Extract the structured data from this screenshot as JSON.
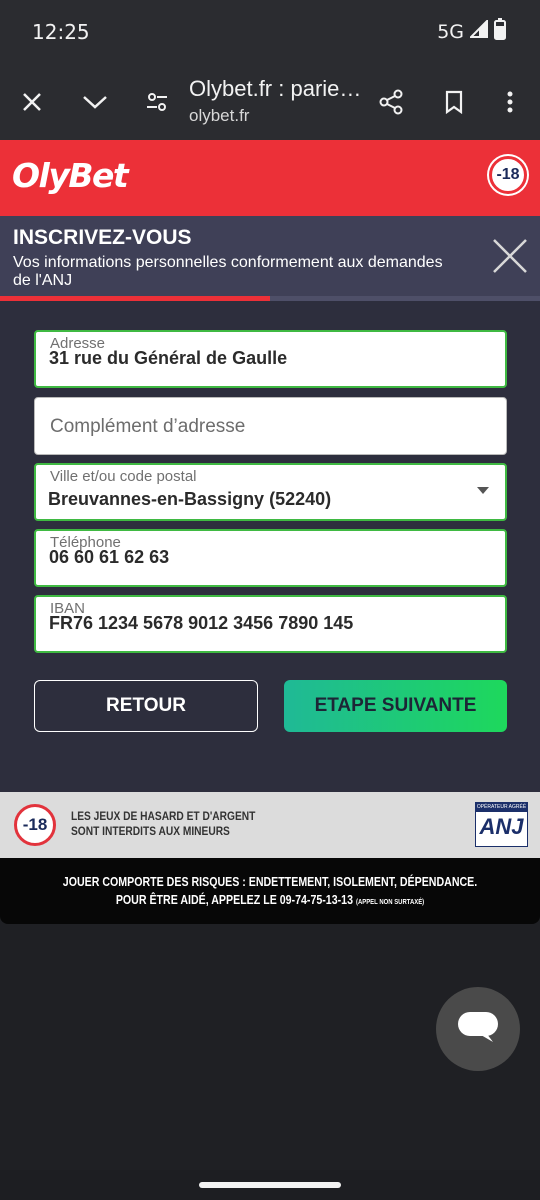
{
  "status_bar": {
    "time": "12:25",
    "network": "5G"
  },
  "browser": {
    "title": "Olybet.fr : parie…",
    "url": "olybet.fr",
    "icons": [
      "close-icon",
      "chevron-down-icon",
      "tune-icon",
      "share-icon",
      "bookmark-icon",
      "more-vert-icon"
    ]
  },
  "header": {
    "logo": "OlyBet",
    "age_badge": "-18"
  },
  "registration": {
    "title": "INSCRIVEZ-VOUS",
    "subtitle": "Vos informations personnelles conformement aux demandes de l'ANJ",
    "progress_fraction": 0.5,
    "fields": {
      "address": {
        "label": "Adresse",
        "value": "31 rue du Général de Gaulle"
      },
      "address_complement": {
        "placeholder": "Complément d’adresse"
      },
      "city": {
        "label": "Ville et/ou code postal",
        "value": "Breuvannes-en-Bassigny (52240)"
      },
      "phone": {
        "label": "Téléphone",
        "value": "06 60 61 62 63"
      },
      "iban": {
        "label": "IBAN",
        "value": "FR76 1234 5678 9012 3456 7890 145"
      }
    },
    "buttons": {
      "back": "RETOUR",
      "next": "ETAPE SUIVANTE"
    }
  },
  "legal": {
    "age_badge": "-18",
    "warning_line1": "LES JEUX DE HASARD ET D'ARGENT",
    "warning_line2": "SONT INTERDITS AUX MINEURS",
    "anj_band": "OPÉRATEUR AGRÉÉ",
    "anj_text": "ANJ",
    "risk_line1": "JOUER COMPORTE DES RISQUES : ENDETTEMENT, ISOLEMENT, DÉPENDANCE.",
    "risk_line2": "POUR ÊTRE AIDÉ, APPELEZ LE 09-74-75-13-13",
    "risk_note": "(APPEL NON SURTAXÉ)"
  },
  "colors": {
    "brand_red": "#ec3038",
    "success_green": "#1ed85c",
    "panel": "#2d2e3d"
  }
}
